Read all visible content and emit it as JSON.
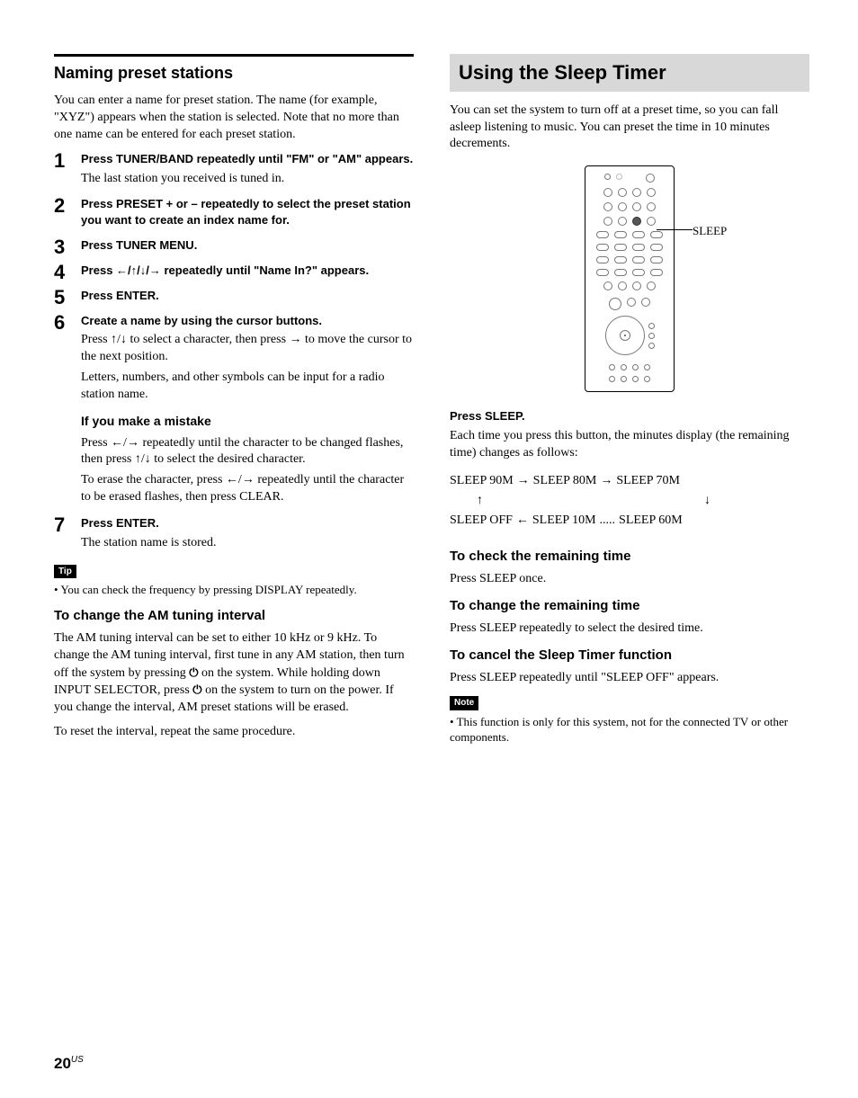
{
  "left": {
    "title": "Naming preset stations",
    "intro": "You can enter a name for preset station. The name (for example, \"XYZ\") appears when the station is selected. Note that no more than one name can be entered for each preset station.",
    "steps": [
      {
        "n": "1",
        "head": "Press TUNER/BAND repeatedly until \"FM\" or \"AM\" appears.",
        "text": "The last station you received is tuned in."
      },
      {
        "n": "2",
        "head": "Press PRESET + or – repeatedly to select the preset station you want to create an index name for.",
        "text": ""
      },
      {
        "n": "3",
        "head": "Press TUNER MENU.",
        "text": ""
      },
      {
        "n": "4",
        "head": "Press ←/↑/↓/→ repeatedly until \"Name In?\" appears.",
        "text": ""
      },
      {
        "n": "5",
        "head": "Press ENTER.",
        "text": ""
      },
      {
        "n": "6",
        "head": "Create a name by using the cursor buttons.",
        "text": "Press ↑/↓ to select a character, then press → to move the cursor to the next position.",
        "text2": "Letters, numbers, and other symbols can be input for a radio station name.",
        "mistake_title": "If you make a mistake",
        "mistake1": "Press ←/→ repeatedly until the character to be changed flashes, then press ↑/↓ to select the desired character.",
        "mistake2": "To erase the character, press ←/→ repeatedly until the character to be erased flashes, then press CLEAR."
      },
      {
        "n": "7",
        "head": "Press ENTER.",
        "text": "The station name is stored."
      }
    ],
    "tip_label": "Tip",
    "tip_text": "You can check the frequency by pressing DISPLAY repeatedly.",
    "am_title": "To change the AM tuning interval",
    "am_p1_a": "The AM tuning interval can be set to either 10 kHz or 9 kHz. To change the AM tuning interval, first tune in any AM station, then turn off the system by pressing ",
    "am_p1_b": " on the system. While holding down INPUT SELECTOR, press ",
    "am_p1_c": " on the system to turn on the power. If you change the interval, AM preset stations will be erased.",
    "am_p2": "To reset the interval, repeat the same procedure."
  },
  "right": {
    "title": "Using the Sleep Timer",
    "intro": "You can set the system to turn off at a preset time, so you can fall asleep listening to music. You can preset the time in 10 minutes decrements.",
    "sleep_label": "SLEEP",
    "press": "Press SLEEP.",
    "press_text": "Each time you press this button, the minutes display (the remaining time) changes as follows:",
    "cycle_top_a": "SLEEP 90M",
    "cycle_top_b": "SLEEP 80M",
    "cycle_top_c": "SLEEP 70M",
    "cycle_bot_a": "SLEEP OFF",
    "cycle_bot_b": "SLEEP 10M",
    "cycle_bot_c": "SLEEP 60M",
    "dots": ".....",
    "check_title": "To check the remaining time",
    "check_text": "Press SLEEP once.",
    "change_title": "To change the remaining time",
    "change_text": "Press SLEEP repeatedly to select the desired time.",
    "cancel_title": "To cancel the Sleep Timer function",
    "cancel_text": "Press SLEEP repeatedly until \"SLEEP OFF\" appears.",
    "note_label": "Note",
    "note_text": "This function is only for this system, not for the connected TV or other components."
  },
  "footer": {
    "page": "20",
    "suffix": "US"
  }
}
